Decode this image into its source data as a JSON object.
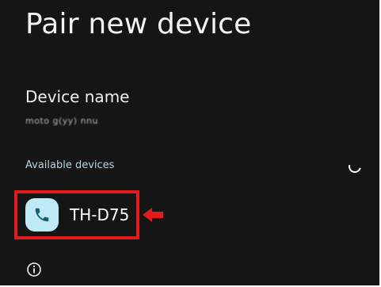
{
  "page": {
    "title": "Pair new device"
  },
  "device_name": {
    "label": "Device name",
    "value": "moto g(yy) nnu"
  },
  "available": {
    "label": "Available devices",
    "loading": true
  },
  "devices": [
    {
      "label": "TH-D75",
      "icon": "phone-icon"
    }
  ],
  "annotation": {
    "highlight_color": "#e51a1a",
    "arrow_color": "#e51a1a"
  },
  "info": {
    "icon": "info-icon"
  },
  "colors": {
    "background": "#151515",
    "accent_text": "#b7d6e4",
    "device_icon_bg": "#bfe9f4"
  }
}
